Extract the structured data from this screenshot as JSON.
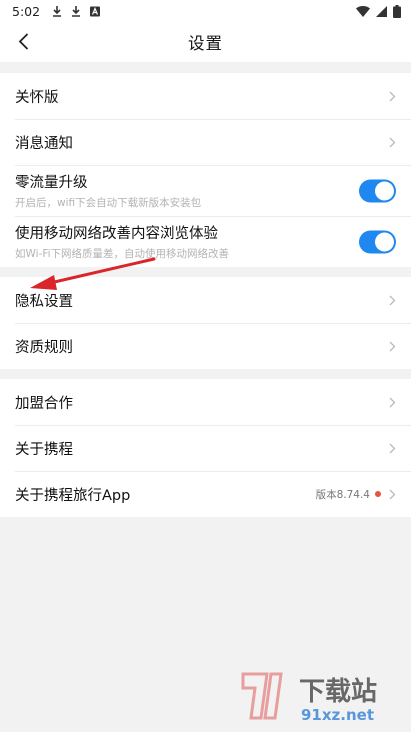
{
  "status_bar": {
    "time": "5:02"
  },
  "header": {
    "title": "设置"
  },
  "groups": {
    "care": {
      "label": "关怀版"
    },
    "notify": {
      "label": "消息通知"
    },
    "zero_traffic": {
      "label": "零流量升级",
      "sub": "开启后，wifi下会自动下载新版本安装包",
      "enabled": true
    },
    "network_boost": {
      "label": "使用移动网络改善内容浏览体验",
      "sub": "如Wi-Fi下网络质量差，自动使用移动网络改善",
      "enabled": true
    },
    "privacy": {
      "label": "隐私设置"
    },
    "qualification": {
      "label": "资质规则"
    },
    "join": {
      "label": "加盟合作"
    },
    "about": {
      "label": "关于携程"
    },
    "about_app": {
      "label": "关于携程旅行App",
      "version": "版本8.74.4"
    }
  },
  "colors": {
    "accent": "#1e87f0",
    "badge": "#e8533b",
    "annotation_arrow": "#d9262a"
  },
  "watermark": {
    "brand": "下载站",
    "domain": "91xz.net"
  }
}
